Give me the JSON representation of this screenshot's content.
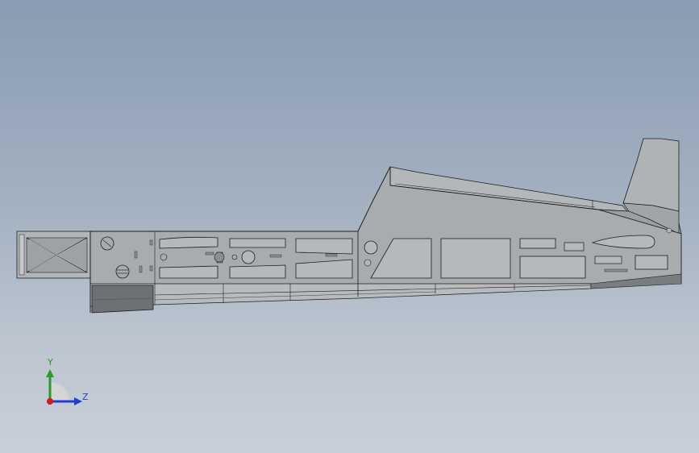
{
  "model": {
    "name": "fuselage-assembly",
    "background_top": "#8a9cb1",
    "background_bottom": "#c9cfd8",
    "part_fill": "#a9acaf",
    "part_dark": "#6e7174",
    "edge_color": "#1c1c1c"
  },
  "triad": {
    "y_label": "Y",
    "z_label": "Z",
    "y_color": "#2a9a2a",
    "z_color": "#1f3fc8",
    "x_color": "#d11a1a"
  }
}
